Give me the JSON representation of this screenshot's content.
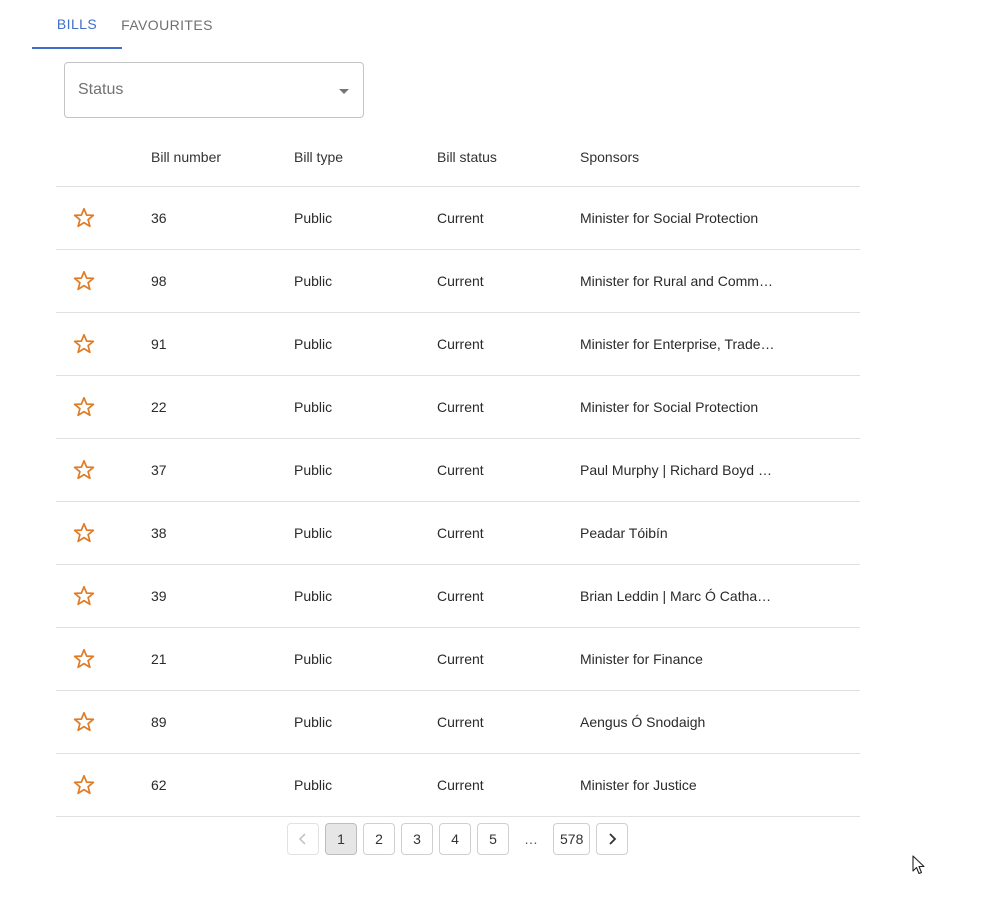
{
  "tabs": [
    {
      "label": "BILLS",
      "active": true
    },
    {
      "label": "FAVOURITES",
      "active": false
    }
  ],
  "filter": {
    "status_label": "Status"
  },
  "table": {
    "headers": {
      "bill_number": "Bill number",
      "bill_type": "Bill type",
      "bill_status": "Bill status",
      "sponsors": "Sponsors"
    },
    "rows": [
      {
        "number": "36",
        "type": "Public",
        "status": "Current",
        "sponsors": "Minister for Social Protection"
      },
      {
        "number": "98",
        "type": "Public",
        "status": "Current",
        "sponsors": "Minister for Rural and Comm…"
      },
      {
        "number": "91",
        "type": "Public",
        "status": "Current",
        "sponsors": "Minister for Enterprise, Trade …"
      },
      {
        "number": "22",
        "type": "Public",
        "status": "Current",
        "sponsors": "Minister for Social Protection"
      },
      {
        "number": "37",
        "type": "Public",
        "status": "Current",
        "sponsors": "Paul Murphy | Richard Boyd B…"
      },
      {
        "number": "38",
        "type": "Public",
        "status": "Current",
        "sponsors": "Peadar Tóibín"
      },
      {
        "number": "39",
        "type": "Public",
        "status": "Current",
        "sponsors": "Brian Leddin | Marc Ó Cathas…"
      },
      {
        "number": "21",
        "type": "Public",
        "status": "Current",
        "sponsors": "Minister for Finance"
      },
      {
        "number": "89",
        "type": "Public",
        "status": "Current",
        "sponsors": "Aengus Ó Snodaigh"
      },
      {
        "number": "62",
        "type": "Public",
        "status": "Current",
        "sponsors": "Minister for Justice"
      }
    ]
  },
  "pagination": {
    "pages": [
      "1",
      "2",
      "3",
      "4",
      "5"
    ],
    "ellipsis": "…",
    "last": "578",
    "current": "1"
  },
  "colors": {
    "accent": "#3f6fc9",
    "star": "#e07b24"
  }
}
